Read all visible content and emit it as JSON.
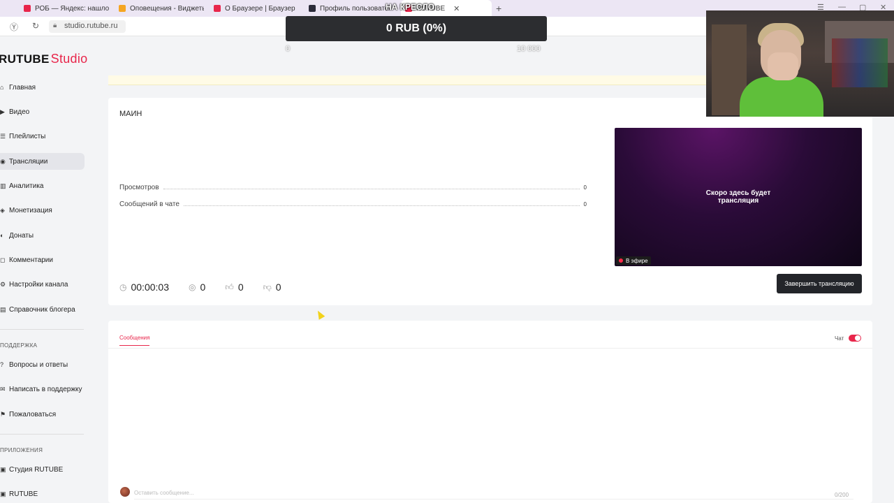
{
  "browser": {
    "tabs": [
      {
        "label": "РОБ — Яндекс: нашлось",
        "color": "#e8264b"
      },
      {
        "label": "Оповещения - Виджеты",
        "color": "#f5a623"
      },
      {
        "label": "О Браузере | Браузер",
        "color": "#e8264b"
      },
      {
        "label": "Профиль пользовател",
        "color": "#2b2b3a"
      },
      {
        "label": "RUTUBE",
        "color": "#e8264b"
      }
    ],
    "url": "studio.rutube.ru"
  },
  "app": {
    "logo_main": "RUTUBE",
    "logo_sub": "Studio"
  },
  "sidebar": {
    "items": [
      {
        "label": "Главная",
        "icon": "home-icon",
        "glyph": "⌂"
      },
      {
        "label": "Видео",
        "icon": "video-icon",
        "glyph": "▶"
      },
      {
        "label": "Плейлисты",
        "icon": "playlist-icon",
        "glyph": "☰"
      },
      {
        "label": "Трансляции",
        "icon": "broadcast-icon",
        "glyph": "◉"
      },
      {
        "label": "Аналитика",
        "icon": "analytics-icon",
        "glyph": "▥"
      },
      {
        "label": "Монетизация",
        "icon": "money-icon",
        "glyph": "◈"
      },
      {
        "label": "Донаты",
        "icon": "donate-icon",
        "glyph": "◐"
      },
      {
        "label": "Комментарии",
        "icon": "comments-icon",
        "glyph": "◻"
      },
      {
        "label": "Настройки канала",
        "icon": "settings-icon",
        "glyph": "⚙"
      },
      {
        "label": "Справочник блогера",
        "icon": "book-icon",
        "glyph": "▤"
      }
    ],
    "support_section": "ПОДДЕРЖКА",
    "support_items": [
      {
        "label": "Вопросы и ответы",
        "icon": "question-icon",
        "glyph": "?"
      },
      {
        "label": "Написать в поддержку",
        "icon": "mail-icon",
        "glyph": "✉"
      },
      {
        "label": "Пожаловаться",
        "icon": "flag-icon",
        "glyph": "⚑"
      }
    ],
    "apps_section": "ПРИЛОЖЕНИЯ",
    "apps_items": [
      {
        "label": "Студия RUTUBE",
        "icon": "studio-app-icon",
        "glyph": "▣"
      },
      {
        "label": "RUTUBE",
        "icon": "rutube-app-icon",
        "glyph": "▣"
      }
    ]
  },
  "stream": {
    "title": "МАИН",
    "stats": [
      {
        "label": "Просмотров",
        "value": "0"
      },
      {
        "label": "Сообщений в чате",
        "value": "0"
      }
    ],
    "timer": "00:00:03",
    "viewers": "0",
    "likes": "0",
    "dislikes": "0",
    "preview_text_1": "Скоро здесь будет",
    "preview_text_2": "трансляция",
    "live_label": "В эфире",
    "end_button": "Завершить трансляцию"
  },
  "chat": {
    "tab_label": "Сообщения",
    "toggle_label": "Чат",
    "toggle_on": true,
    "placeholder": "Оставить сообщение...",
    "counter": "0/200"
  },
  "donation_overlay": {
    "title": "НА КРЕСЛО",
    "amount": "0 RUB (0%)",
    "progress": 0,
    "min": "0",
    "max": "10 000"
  }
}
